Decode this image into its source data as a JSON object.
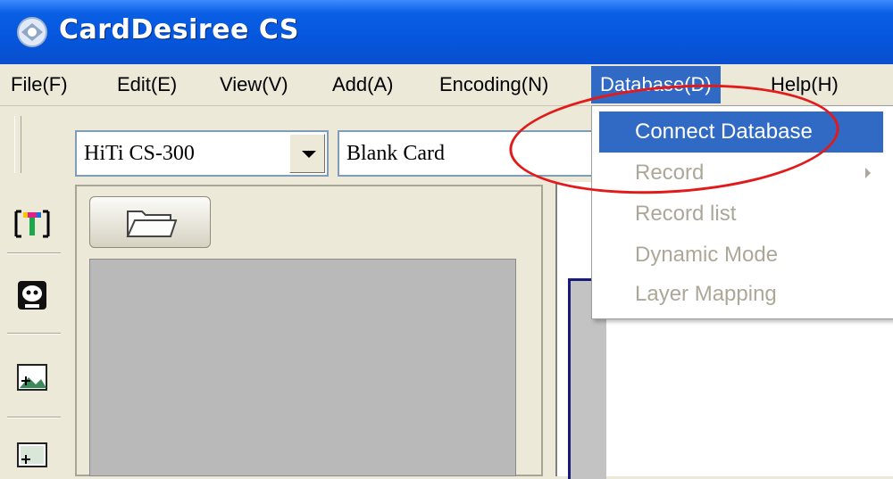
{
  "window": {
    "title": "CardDesiree CS",
    "title_bar_color": "#0556dc"
  },
  "menubar": {
    "items": [
      {
        "label": "File(F)"
      },
      {
        "label": "Edit(E)"
      },
      {
        "label": "View(V)"
      },
      {
        "label": "Add(A)"
      },
      {
        "label": "Encoding(N)"
      },
      {
        "label": "Database(D)"
      },
      {
        "label": "Help(H)"
      }
    ],
    "open_menu": "Database(D)"
  },
  "toolbar": {
    "printer_select": {
      "value": "HiTi CS-300"
    },
    "card_select": {
      "value": "Blank Card"
    }
  },
  "tools": [
    {
      "icon": "text-tool-icon"
    },
    {
      "icon": "face-tool-icon"
    },
    {
      "icon": "image-tool-icon"
    },
    {
      "icon": "frame-tool-icon"
    }
  ],
  "database_menu": {
    "items": [
      {
        "label": "Connect Database",
        "enabled": true,
        "highlighted": true
      },
      {
        "label": "Record",
        "enabled": false,
        "submenu": true
      },
      {
        "label": "Record list",
        "enabled": false
      },
      {
        "label": "Dynamic Mode",
        "enabled": false
      },
      {
        "label": "Layer Mapping",
        "enabled": false
      }
    ]
  },
  "annotation": {
    "shape": "ellipse",
    "color": "#e21a1a",
    "target": "Connect Database"
  },
  "colors": {
    "menu_highlight": "#316ac5",
    "disabled_text": "#aca899",
    "face": "#ece9d8"
  }
}
